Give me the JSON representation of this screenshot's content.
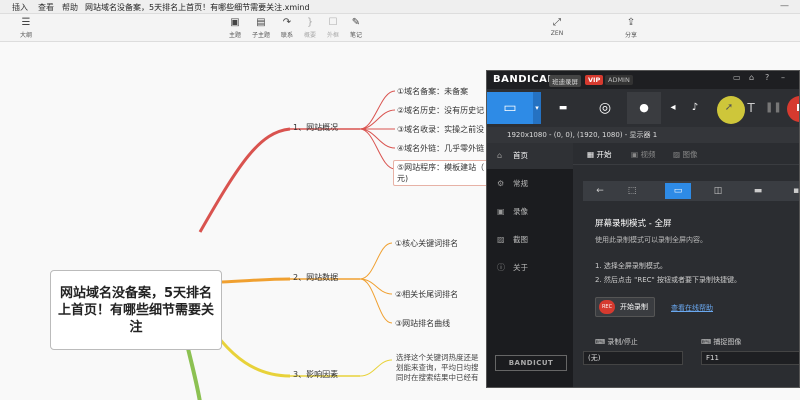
{
  "app": {
    "title": "网站域名没备案，5天排名上首页！有哪些细节需要关注.xmind",
    "menu": [
      "插入",
      "查看",
      "帮助"
    ],
    "toolbar": [
      {
        "icon": "☰",
        "label": "大纲"
      },
      {
        "icon": "▣",
        "label": "主题"
      },
      {
        "icon": "▤",
        "label": "子主题"
      },
      {
        "icon": "↷",
        "label": "联系"
      },
      {
        "icon": "}",
        "label": "概要"
      },
      {
        "icon": "☐",
        "label": "外框"
      },
      {
        "icon": "✎",
        "label": "笔记"
      },
      {
        "icon": "⤢",
        "label": "ZEN"
      },
      {
        "icon": "⇪",
        "label": "分享"
      }
    ]
  },
  "mindmap": {
    "central": "网站域名没备案，5天排名上首页！有哪些细节需要关注",
    "branches": [
      {
        "label": "1、网站概况",
        "children": [
          "①域名备案：未备案",
          "②域名历史：没有历史记",
          "③域名收录：实操之前没",
          "④域名外链：几乎零外链",
          "⑤网站程序：模板建站（",
          "元)"
        ]
      },
      {
        "label": "2、网站数据",
        "children": [
          "①核心关键词排名",
          "②相关长尾词排名",
          "③网站排名曲线"
        ]
      },
      {
        "label": "3、影响因素",
        "notes": [
          "选择这个关键词热度还是",
          "划能来查询，平均日均搜",
          "同时在搜索结果中已经有"
        ]
      }
    ],
    "colors": {
      "branch1": "#d9534f",
      "branch2": "#f0a030",
      "branch3": "#e8d23a",
      "branch4": "#8cc152"
    }
  },
  "bandicam": {
    "logo": "BANDICAM",
    "tag_cn": "班迪录屏",
    "tag_vip": "VIP",
    "tag_admin": "ADMIN",
    "modes": [
      "screen-mode",
      "hdmi-mode",
      "game-mode"
    ],
    "rec_label": "R",
    "info": "1920x1080 - (0, 0), (1920, 1080) - 显示器 1",
    "sidebar": [
      "首页",
      "常规",
      "录像",
      "截图",
      "关于"
    ],
    "bandicut": "BANDICUT",
    "tabs": [
      "开始",
      "视频",
      "图像"
    ],
    "mode_title": "屏幕录制模式 - 全屏",
    "mode_desc": "使用此录制模式可以录制全屏内容。",
    "steps": [
      "1. 选择全屏录制模式。",
      "2. 然后点击 \"REC\" 按钮或者要下录制快捷键。"
    ],
    "start_rec_icon": "REC",
    "start_button": "开始录制",
    "help_link": "查看在线帮助",
    "hotkeys": [
      {
        "label": "录制/停止",
        "value": "(无)"
      },
      {
        "label": "捕捉图像",
        "value": "F11"
      }
    ]
  }
}
